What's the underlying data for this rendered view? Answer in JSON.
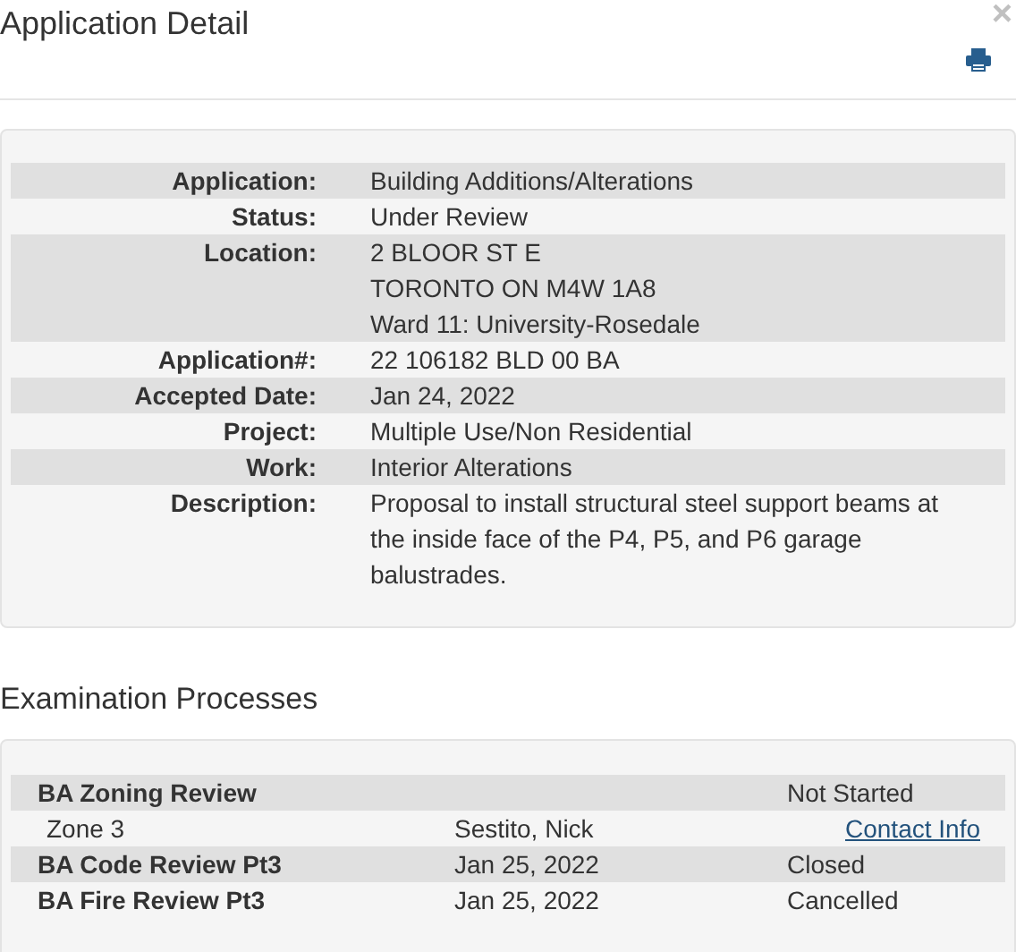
{
  "dialog": {
    "title": "Application Detail",
    "close": "×"
  },
  "details": [
    {
      "label": "Application:",
      "lines": [
        "Building Additions/Alterations"
      ]
    },
    {
      "label": "Status:",
      "lines": [
        "Under Review"
      ]
    },
    {
      "label": "Location:",
      "lines": [
        "2 BLOOR ST E",
        "TORONTO ON M4W 1A8",
        "Ward 11: University-Rosedale"
      ]
    },
    {
      "label": "Application#:",
      "lines": [
        "22 106182 BLD 00 BA"
      ]
    },
    {
      "label": "Accepted Date:",
      "lines": [
        "Jan 24, 2022"
      ]
    },
    {
      "label": "Project:",
      "lines": [
        "Multiple Use/Non Residential"
      ]
    },
    {
      "label": "Work:",
      "lines": [
        "Interior Alterations"
      ]
    },
    {
      "label": "Description:",
      "lines": [
        "Proposal to install structural steel support beams at the inside face of the P4, P5, and P6 garage balustrades."
      ]
    }
  ],
  "examination": {
    "title": "Examination Processes",
    "rows": [
      {
        "kind": "process",
        "name": "BA Zoning Review",
        "status": "Not Started"
      },
      {
        "kind": "examiner",
        "name": "Zone 3",
        "person": "Sestito, Nick",
        "link": "Contact Info"
      },
      {
        "kind": "process",
        "name": "BA Code Review Pt3",
        "date": "Jan 25, 2022",
        "status": "Closed"
      },
      {
        "kind": "process",
        "name": "BA Fire Review Pt3",
        "date": "Jan 25, 2022",
        "status": "Cancelled"
      }
    ]
  }
}
